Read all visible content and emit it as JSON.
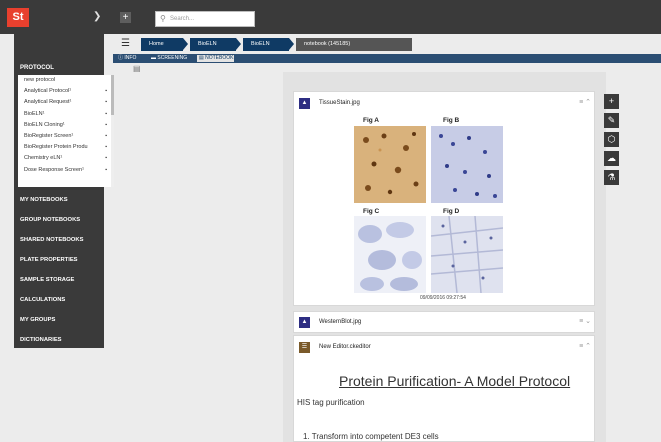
{
  "app": {
    "logo": "St",
    "menu_chevron": "chevron-down-icon"
  },
  "search": {
    "placeholder": "Search..."
  },
  "sidebar": {
    "protocol_header": "PROTOCOL",
    "protocols": [
      {
        "label": "new protocol",
        "mark": ""
      },
      {
        "label": "Analytical Protocol¹",
        "mark": "▪"
      },
      {
        "label": "Analytical Request¹",
        "mark": "▪"
      },
      {
        "label": "BioELN¹",
        "mark": "▪"
      },
      {
        "label": "BioELN Cloning¹",
        "mark": "▪"
      },
      {
        "label": "BioRegister Screen¹",
        "mark": "▪"
      },
      {
        "label": "BioRegister Protein Produ",
        "mark": "▪"
      },
      {
        "label": "Chemistry eLN¹",
        "mark": "▪"
      },
      {
        "label": "Dose Response Screen¹",
        "mark": "▪"
      }
    ],
    "nav": [
      "MY NOTEBOOKS",
      "GROUP NOTEBOOKS",
      "SHARED NOTEBOOKS",
      "PLATE PROPERTIES",
      "SAMPLE STORAGE",
      "CALCULATIONS",
      "MY GROUPS",
      "DICTIONARIES"
    ]
  },
  "breadcrumb": {
    "items": [
      "Home",
      "BioELN",
      "BioELN",
      "notebook (145185)"
    ]
  },
  "tabs": {
    "items": [
      "INFO",
      "SCREENING",
      "NOTEBOOK"
    ]
  },
  "cards": {
    "tissue": {
      "title": "TissueStain.jpg",
      "figures": [
        "Fig A",
        "Fig B",
        "Fig C",
        "Fig D"
      ],
      "timestamp": "09/09/2016 09:27:54"
    },
    "western": {
      "title": "WesternBlot.jpg"
    },
    "editor": {
      "title": "New Editor.ckeditor"
    }
  },
  "document": {
    "heading": "Protein Purification- A Model Protocol",
    "subheading": "HIS tag purification",
    "step1": "1. Transform into competent DE3 cells"
  },
  "right_tools": [
    "plus-icon",
    "pencil-icon",
    "hexagon-icon",
    "cloud-icon",
    "flask-icon"
  ]
}
